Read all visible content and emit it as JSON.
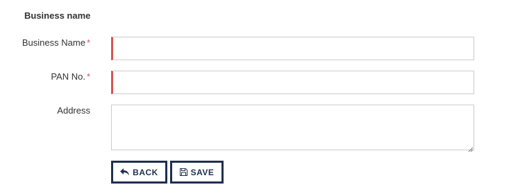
{
  "section": {
    "title": "Business name"
  },
  "form": {
    "business_name": {
      "label": "Business Name",
      "required_mark": "*",
      "value": "",
      "required": true
    },
    "pan_no": {
      "label": "PAN No.",
      "required_mark": "*",
      "value": "",
      "required": true
    },
    "address": {
      "label": "Address",
      "value": ""
    }
  },
  "actions": {
    "back": {
      "label": "BACK",
      "icon": "reply-arrow-icon"
    },
    "save": {
      "label": "SAVE",
      "icon": "floppy-disk-icon"
    }
  },
  "colors": {
    "required_accent": "#d9534f",
    "button_border": "#1f2f4f",
    "field_border": "#cccccc"
  }
}
